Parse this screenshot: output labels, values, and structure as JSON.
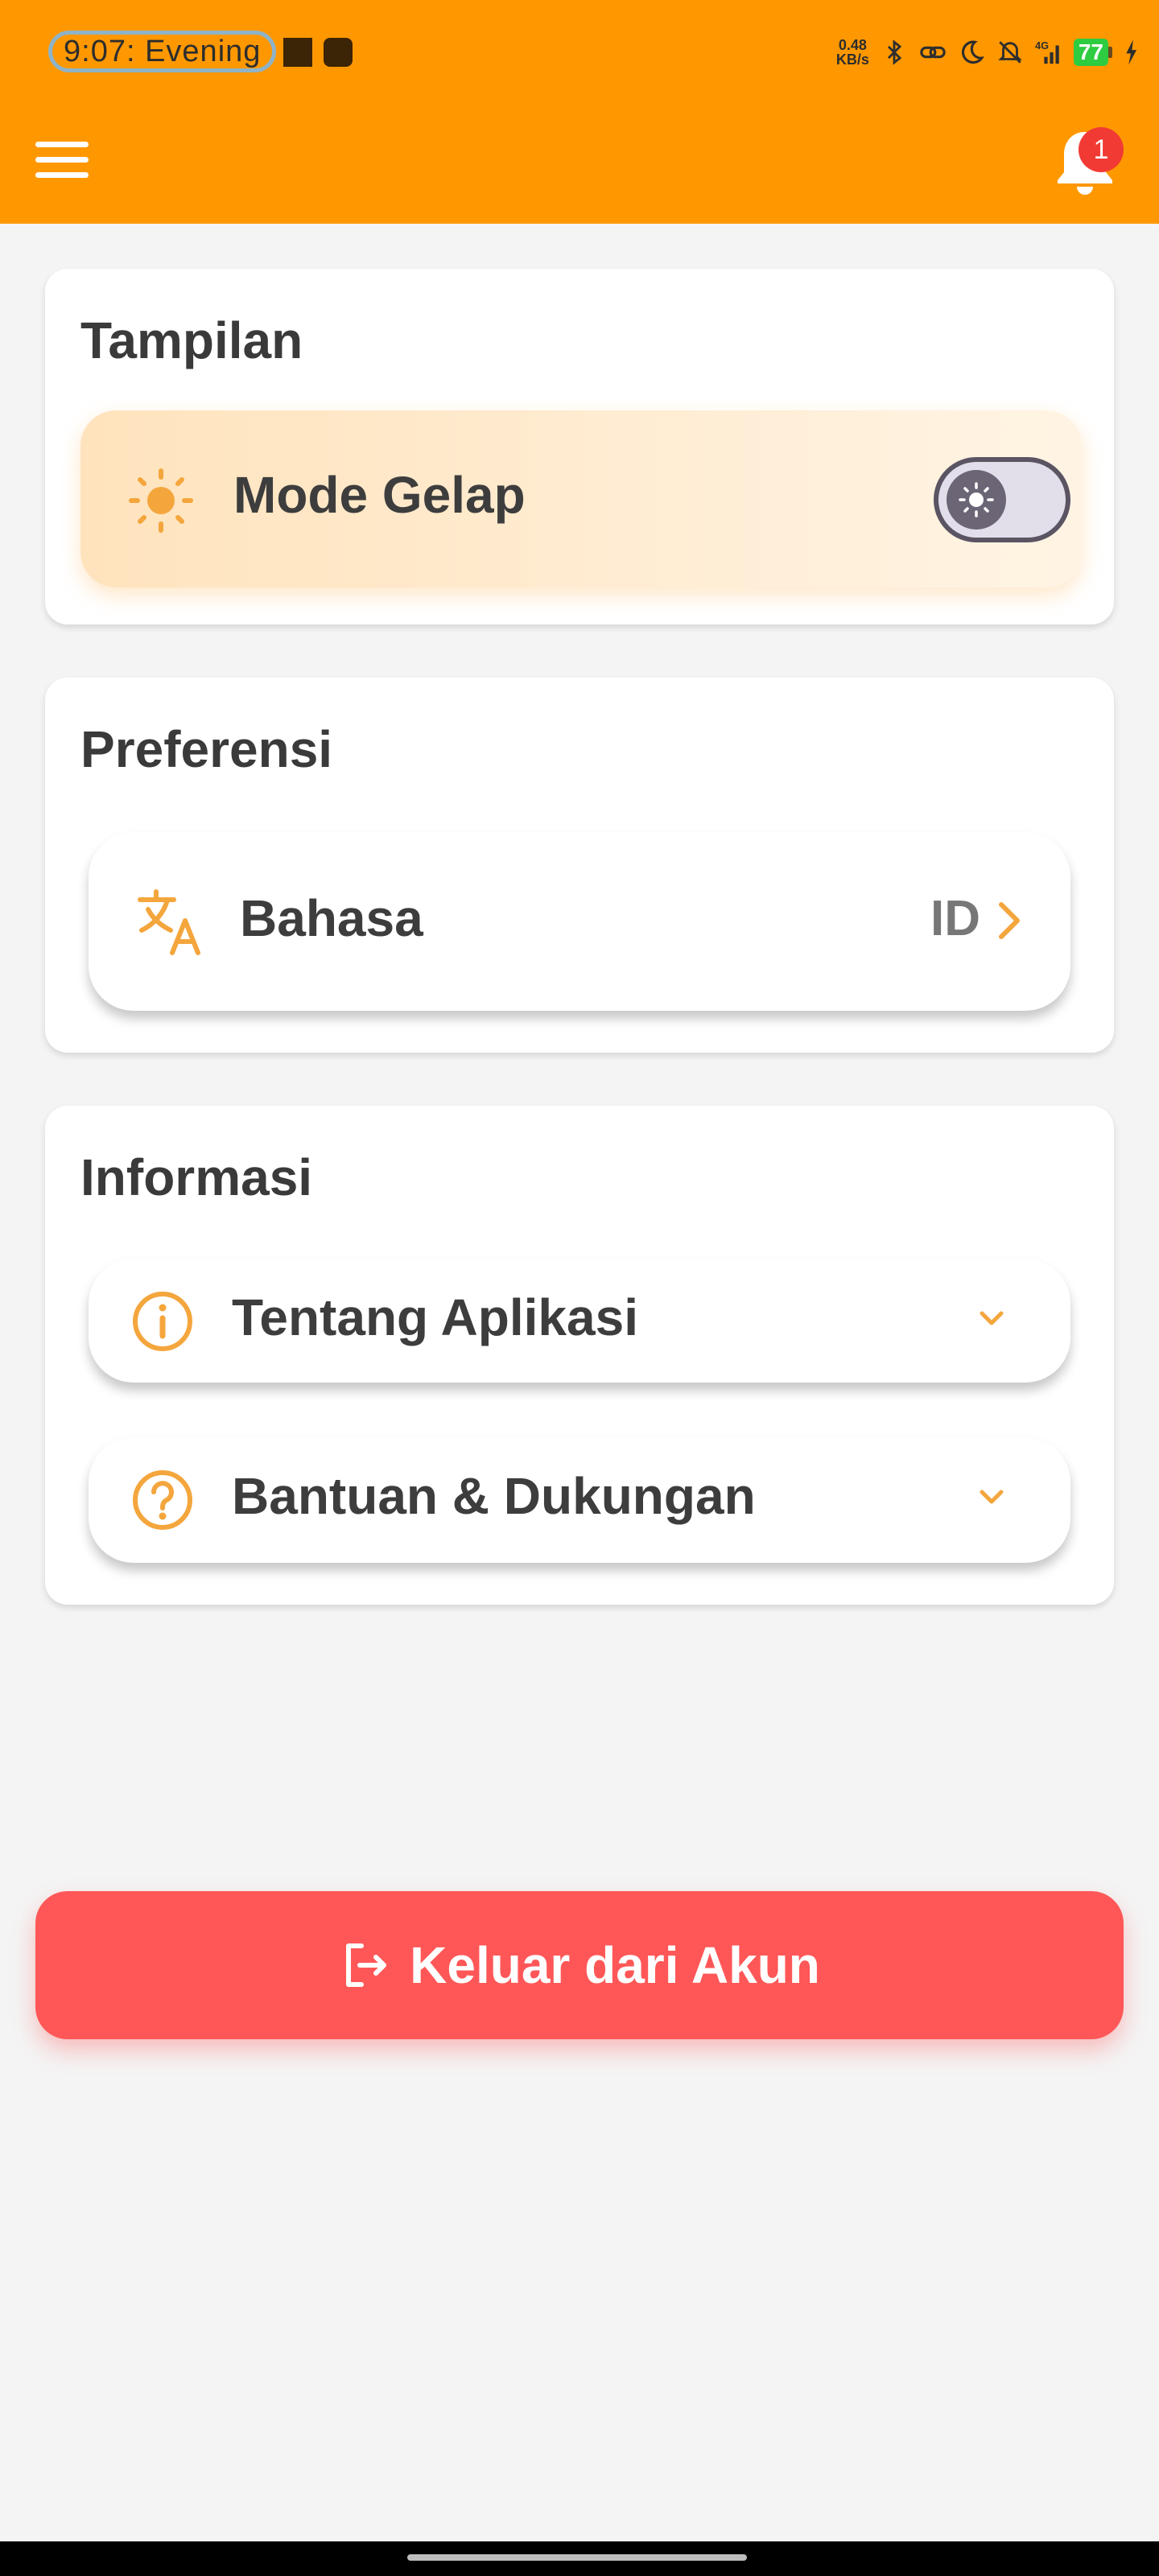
{
  "status_bar": {
    "time": "9:07:  Evening",
    "net_speed_value": "0.48",
    "net_speed_unit": "KB/s",
    "network": "4G",
    "battery": "77"
  },
  "header": {
    "notification_count": "1"
  },
  "sections": {
    "appearance": {
      "title": "Tampilan",
      "dark_mode_label": "Mode Gelap",
      "dark_mode_on": false
    },
    "preferences": {
      "title": "Preferensi",
      "language_label": "Bahasa",
      "language_value": "ID"
    },
    "info": {
      "title": "Informasi",
      "about_label": "Tentang Aplikasi",
      "help_label": "Bantuan & Dukungan"
    }
  },
  "logout": {
    "label": "Keluar dari Akun"
  },
  "colors": {
    "accent": "#ff9800",
    "icon": "#f4a63d",
    "danger": "#ff5757",
    "badge": "#f23a35"
  }
}
